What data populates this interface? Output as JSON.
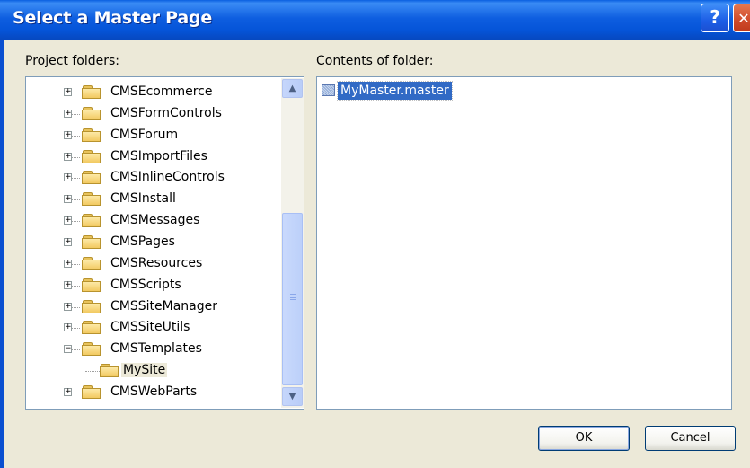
{
  "window": {
    "title": "Select a Master Page",
    "help_glyph": "?",
    "close_glyph": "✕"
  },
  "project_folders": {
    "label_prefix": "P",
    "label_rest": "roject folders:",
    "items": [
      {
        "name": "CMSEcommerce",
        "expander": "+"
      },
      {
        "name": "CMSFormControls",
        "expander": "+"
      },
      {
        "name": "CMSForum",
        "expander": "+"
      },
      {
        "name": "CMSImportFiles",
        "expander": "+"
      },
      {
        "name": "CMSInlineControls",
        "expander": "+"
      },
      {
        "name": "CMSInstall",
        "expander": "+"
      },
      {
        "name": "CMSMessages",
        "expander": "+"
      },
      {
        "name": "CMSPages",
        "expander": "+"
      },
      {
        "name": "CMSResources",
        "expander": "+"
      },
      {
        "name": "CMSScripts",
        "expander": "+"
      },
      {
        "name": "CMSSiteManager",
        "expander": "+"
      },
      {
        "name": "CMSSiteUtils",
        "expander": "+"
      },
      {
        "name": "CMSTemplates",
        "expander": "−"
      },
      {
        "name": "MySite",
        "expander": ""
      },
      {
        "name": "CMSWebParts",
        "expander": "+"
      }
    ],
    "scroll_up_glyph": "▲",
    "scroll_down_glyph": "▼"
  },
  "contents": {
    "label_prefix": "C",
    "label_rest": "ontents of folder:",
    "files": [
      {
        "name": "MyMaster.master",
        "icon": "master-page-file-icon"
      }
    ]
  },
  "buttons": {
    "ok": "OK",
    "cancel": "Cancel"
  },
  "colors": {
    "titlebar": "#0554d8",
    "selection": "#316ac5",
    "dialog_bg": "#ece9d8"
  }
}
